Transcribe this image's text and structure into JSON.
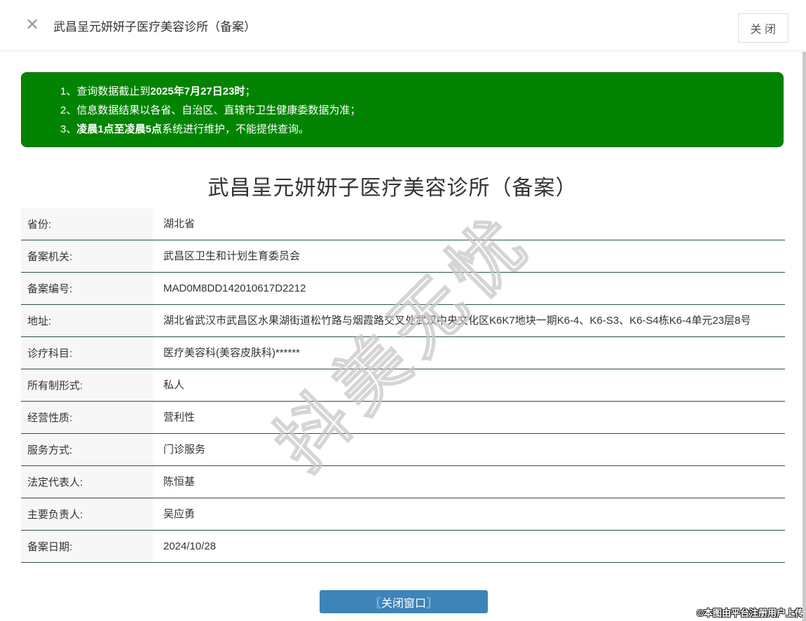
{
  "header": {
    "close_icon": "✕",
    "title": "武昌呈元妍妍子医疗美容诊所（备案）",
    "close_button_label": "关 闭"
  },
  "notice": {
    "lines": [
      {
        "num": "1、",
        "pre": "查询数据截止到",
        "bold": "2025年7月27日23时",
        "post": "；"
      },
      {
        "num": "2、",
        "pre": "信息数据结果以各省、自治区、直辖市卫生健康委数据为准；",
        "bold": "",
        "post": ""
      },
      {
        "num": "3、",
        "pre": "",
        "bold": "凌晨1点至凌晨5点",
        "post": "系统进行维护，不能提供查询。"
      }
    ]
  },
  "main": {
    "title": "武昌呈元妍妍子医疗美容诊所（备案）"
  },
  "table": {
    "rows": [
      {
        "label": "省份:",
        "value": "湖北省"
      },
      {
        "label": "备案机关:",
        "value": "武昌区卫生和计划生育委员会"
      },
      {
        "label": "备案编号:",
        "value": "MAD0M8DD142010617D2212"
      },
      {
        "label": "地址:",
        "value": "湖北省武汉市武昌区水果湖街道松竹路与烟霞路交叉处武汉中央文化区K6K7地块一期K6-4、K6-S3、K6-S4栋K6-4单元23层8号"
      },
      {
        "label": "诊疗科目:",
        "value": "医疗美容科(美容皮肤科)******"
      },
      {
        "label": "所有制形式:",
        "value": "私人"
      },
      {
        "label": "经营性质:",
        "value": "营利性"
      },
      {
        "label": "服务方式:",
        "value": "门诊服务"
      },
      {
        "label": "法定代表人:",
        "value": "陈恒基"
      },
      {
        "label": "主要负责人:",
        "value": "吴应勇"
      },
      {
        "label": "备案日期:",
        "value": "2024/10/28"
      }
    ]
  },
  "footer": {
    "close_window_button": "〖关闭窗口〗",
    "upload_note": "©本图由平台注册用户上传"
  },
  "watermark": "抖美无忧",
  "colors": {
    "notice_green": "#028402",
    "divider_dark": "#2f4f4f",
    "button_blue": "#3d84b8",
    "label_bg": "#f7f7f7"
  }
}
